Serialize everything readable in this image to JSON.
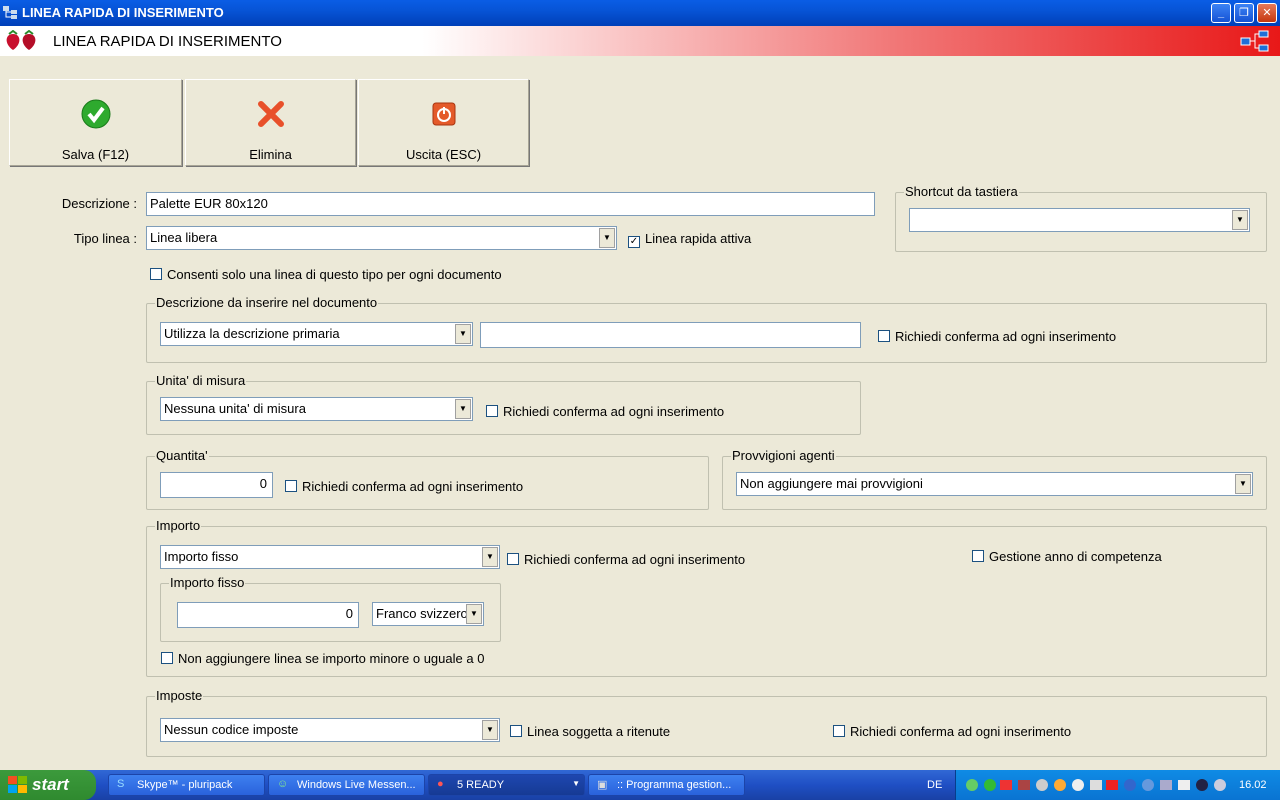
{
  "window": {
    "title": "LINEA RAPIDA DI INSERIMENTO"
  },
  "header": {
    "title": "LINEA RAPIDA DI INSERIMENTO"
  },
  "toolbar": {
    "save_label": "Salva (F12)",
    "delete_label": "Elimina",
    "exit_label": "Uscita (ESC)"
  },
  "form": {
    "descrizione_label": "Descrizione :",
    "descrizione_value": "Palette EUR 80x120",
    "tipo_linea_label": "Tipo linea :",
    "tipo_linea_value": "Linea libera",
    "linea_rapida_attiva_label": "Linea rapida attiva",
    "consenti_label": "Consenti solo una linea di questo tipo per ogni documento"
  },
  "shortcut": {
    "legend": "Shortcut da tastiera",
    "value": ""
  },
  "descrizione_doc": {
    "legend": "Descrizione da inserire nel documento",
    "select_value": "Utilizza la descrizione primaria",
    "text_value": "",
    "confirm_label": "Richiedi conferma ad ogni inserimento"
  },
  "unita": {
    "legend": "Unita' di misura",
    "select_value": "Nessuna unita' di misura",
    "confirm_label": "Richiedi conferma ad ogni inserimento"
  },
  "quantita": {
    "legend": "Quantita'",
    "value": "0",
    "confirm_label": "Richiedi conferma ad ogni inserimento"
  },
  "provvigioni": {
    "legend": "Provvigioni agenti",
    "select_value": "Non aggiungere mai provvigioni"
  },
  "importo": {
    "legend": "Importo",
    "select_value": "Importo fisso",
    "confirm_label": "Richiedi conferma ad ogni inserimento",
    "gestione_label": "Gestione anno di competenza",
    "fisso_legend": "Importo fisso",
    "fisso_value": "0",
    "valuta_value": "Franco svizzero",
    "non_aggiungere_label": "Non aggiungere linea se importo minore o uguale a 0"
  },
  "imposte": {
    "legend": "Imposte",
    "select_value": "Nessun codice imposte",
    "ritenute_label": "Linea soggetta a ritenute",
    "confirm_label": "Richiedi conferma ad ogni inserimento"
  },
  "taskbar": {
    "start_label": "start",
    "tasks": [
      "Skype™ - pluripack",
      "Windows Live Messen...",
      "5 READY",
      ":: Programma gestion..."
    ],
    "lang": "DE",
    "clock": "16.02"
  },
  "colors": {
    "accent_red": "#e81818",
    "xp_blue": "#0754d6",
    "face": "#ece9d8"
  }
}
